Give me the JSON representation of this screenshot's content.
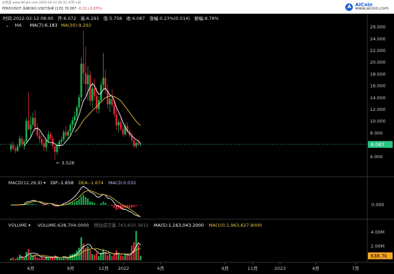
{
  "header": {
    "source_line": "分享自 www.AICoin.com   2022-02-14 20:12 (UTC+8)",
    "pair_line": "PERP/USDT 永续OKX USDT永续 [1日]",
    "pair_price": "76.087",
    "pair_change": "-0.13 (-2.05%)",
    "logo_name": "AICoin",
    "logo_url": "www.aicoin.com"
  },
  "info": {
    "time": "时间:2022-02-12 08:00",
    "open": "开:6.072",
    "high": "高:6.291",
    "low": "低:5.758",
    "close": "收:6.087",
    "change": "涨幅:0.23%(0.014)",
    "amplitude": "振幅:8.78%"
  },
  "ma_legend": {
    "chevron": "⌄",
    "label": "MA",
    "ma7": "MA(7):6.183",
    "ma30": "MA(30):9.292"
  },
  "macd_legend": {
    "label": "MACD(12,26,9) ▾",
    "dif": "DIF:-1.658",
    "dea": "DEA:-1.674",
    "macd": "MACD:0.032"
  },
  "vol_legend": {
    "label": "VOLUME ▾",
    "volume": "VOLUME:638,704.0000",
    "est": "预估成交量:763,810.3615",
    "ma5": "MA(5):1,163,043.2000",
    "ma10": "MA(10):1,963,627.8000"
  },
  "colors": {
    "up": "#1db954",
    "down": "#e0293a",
    "ma7": "#ffffff",
    "ma30": "#e8c547",
    "badge": "#26c281",
    "vol_badge": "#f5a623"
  },
  "chart_data": [
    {
      "type": "candlestick",
      "title": "PERP/USDT 1D",
      "ylim": [
        2,
        27
      ],
      "y_ticks": [
        "26.000",
        "24.000",
        "22.000",
        "20.000",
        "18.000",
        "16.000",
        "14.000",
        "12.000",
        "10.000",
        "8.000",
        "6.000",
        "4.000"
      ],
      "current_price": "6.087",
      "low_marker": "← 3.528",
      "x_ticks": [
        "6月",
        "9月",
        "12月",
        "2022",
        "4月",
        "9月",
        "11月",
        "2023",
        "4月",
        "7月"
      ],
      "candles": [
        [
          5.2,
          6.4,
          4.8,
          6.0
        ],
        [
          6.0,
          6.6,
          5.1,
          5.4
        ],
        [
          5.4,
          5.9,
          4.6,
          5.0
        ],
        [
          5.0,
          6.2,
          4.8,
          5.8
        ],
        [
          5.8,
          7.6,
          5.5,
          7.1
        ],
        [
          7.1,
          7.5,
          5.6,
          6.1
        ],
        [
          6.1,
          7.0,
          5.2,
          6.6
        ],
        [
          6.6,
          10.6,
          6.2,
          10.1
        ],
        [
          10.1,
          14.9,
          9.2,
          8.6
        ],
        [
          8.6,
          10.9,
          7.2,
          9.4
        ],
        [
          9.4,
          11.5,
          8.8,
          10.6
        ],
        [
          10.6,
          11.9,
          8.4,
          9.0
        ],
        [
          9.0,
          9.6,
          7.2,
          7.6
        ],
        [
          7.6,
          8.4,
          6.4,
          7.0
        ],
        [
          7.0,
          7.9,
          5.9,
          6.3
        ],
        [
          6.3,
          7.0,
          5.0,
          5.6
        ],
        [
          5.6,
          7.1,
          4.9,
          6.8
        ],
        [
          6.8,
          8.4,
          6.3,
          7.8
        ],
        [
          7.8,
          8.2,
          6.6,
          7.1
        ],
        [
          7.1,
          7.6,
          5.3,
          5.8
        ],
        [
          5.8,
          6.2,
          3.5,
          4.8
        ],
        [
          4.8,
          6.3,
          4.3,
          5.9
        ],
        [
          5.9,
          6.9,
          5.4,
          6.6
        ],
        [
          6.6,
          7.4,
          6.1,
          6.9
        ],
        [
          6.9,
          8.6,
          6.5,
          8.2
        ],
        [
          8.2,
          9.2,
          7.2,
          7.6
        ],
        [
          7.6,
          8.7,
          7.0,
          8.3
        ],
        [
          8.3,
          9.8,
          7.7,
          9.4
        ],
        [
          9.4,
          10.7,
          8.6,
          10.2
        ],
        [
          10.2,
          11.6,
          9.4,
          10.9
        ],
        [
          10.9,
          12.8,
          10.1,
          12.4
        ],
        [
          12.4,
          14.6,
          11.8,
          14.1
        ],
        [
          14.1,
          20.8,
          13.4,
          19.8
        ],
        [
          19.8,
          25.4,
          16.4,
          18.2
        ],
        [
          18.2,
          22.7,
          14.4,
          16.3
        ],
        [
          16.3,
          19.4,
          13.6,
          17.9
        ],
        [
          17.9,
          18.7,
          12.6,
          13.5
        ],
        [
          13.5,
          16.6,
          12.3,
          15.6
        ],
        [
          15.6,
          17.3,
          13.6,
          14.3
        ],
        [
          14.3,
          15.7,
          11.4,
          12.1
        ],
        [
          12.1,
          14.3,
          11.3,
          13.6
        ],
        [
          13.6,
          16.8,
          13.1,
          16.2
        ],
        [
          16.2,
          21.6,
          15.4,
          17.4
        ],
        [
          17.4,
          18.7,
          14.6,
          15.3
        ],
        [
          15.3,
          16.4,
          12.2,
          12.9
        ],
        [
          12.9,
          14.7,
          11.6,
          13.8
        ],
        [
          13.8,
          15.4,
          12.3,
          12.8
        ],
        [
          12.8,
          13.6,
          10.7,
          11.2
        ],
        [
          11.2,
          12.1,
          8.6,
          9.3
        ],
        [
          9.3,
          10.4,
          8.1,
          9.9
        ],
        [
          9.9,
          10.6,
          8.3,
          8.7
        ],
        [
          8.7,
          9.4,
          7.4,
          7.8
        ],
        [
          7.8,
          9.7,
          7.5,
          9.2
        ],
        [
          9.2,
          9.8,
          8.0,
          8.3
        ],
        [
          8.3,
          8.7,
          7.3,
          7.6
        ],
        [
          7.6,
          8.1,
          6.4,
          6.8
        ],
        [
          6.8,
          7.1,
          5.4,
          5.8
        ],
        [
          5.8,
          6.6,
          5.5,
          6.3
        ],
        [
          6.3,
          6.8,
          5.8,
          6.1
        ],
        [
          6.072,
          6.291,
          5.758,
          6.087
        ]
      ],
      "ma7": [
        null,
        null,
        null,
        null,
        null,
        null,
        5.8,
        6.3,
        6.8,
        7.3,
        8.2,
        8.8,
        8.8,
        8.6,
        8.0,
        7.5,
        6.9,
        6.5,
        6.4,
        6.4,
        6.2,
        5.9,
        5.9,
        5.9,
        6.1,
        6.6,
        7.0,
        7.5,
        8.3,
        9.1,
        10.1,
        11.1,
        12.3,
        13.5,
        14.1,
        15.0,
        15.8,
        16.4,
        16.1,
        15.2,
        14.6,
        14.7,
        15.4,
        15.6,
        15.1,
        14.5,
        14.3,
        13.5,
        12.4,
        11.6,
        10.8,
        9.8,
        9.0,
        8.4,
        8.0,
        7.6,
        7.2,
        6.9,
        6.7,
        6.2
      ],
      "ma30": [
        null,
        null,
        null,
        null,
        null,
        null,
        null,
        null,
        null,
        null,
        null,
        null,
        null,
        null,
        null,
        null,
        null,
        null,
        null,
        null,
        null,
        null,
        null,
        null,
        null,
        null,
        null,
        null,
        null,
        8.2,
        8.5,
        9.0,
        9.6,
        10.2,
        10.6,
        11.0,
        11.4,
        11.8,
        12.2,
        12.5,
        12.9,
        13.3,
        13.7,
        14.0,
        14.2,
        14.3,
        14.3,
        14.2,
        14.0,
        13.8,
        13.5,
        13.0,
        12.5,
        12.0,
        11.5,
        11.0,
        10.5,
        10.0,
        9.6,
        9.3
      ]
    },
    {
      "type": "bar",
      "title": "MACD(12,26,9)",
      "y_ticks": [
        "0.000"
      ],
      "ylim": [
        -1.6,
        2.6
      ],
      "dif_label": "DIF",
      "dea_label": "DEA",
      "hist": [
        0.02,
        0.01,
        -0.02,
        -0.01,
        0.03,
        0.02,
        0.03,
        0.15,
        0.12,
        0.14,
        0.16,
        0.1,
        0.02,
        -0.02,
        -0.06,
        -0.1,
        -0.05,
        0.04,
        0.02,
        -0.06,
        -0.16,
        -0.1,
        -0.02,
        0.02,
        0.12,
        0.14,
        0.18,
        0.25,
        0.35,
        0.45,
        0.6,
        0.8,
        1.2,
        1.4,
        1.1,
        0.9,
        0.5,
        0.45,
        0.3,
        0.05,
        0.05,
        0.25,
        0.45,
        0.3,
        -0.1,
        -0.05,
        -0.15,
        -0.4,
        -0.7,
        -0.55,
        -0.6,
        -0.65,
        -0.4,
        -0.45,
        -0.4,
        -0.35,
        -0.3,
        -0.15,
        -0.05,
        0.032
      ],
      "dif": [
        0,
        0,
        0,
        0,
        0.05,
        0.05,
        0.1,
        0.4,
        0.45,
        0.55,
        0.65,
        0.6,
        0.5,
        0.4,
        0.25,
        0.1,
        0.1,
        0.2,
        0.2,
        0.1,
        -0.1,
        -0.15,
        -0.1,
        0,
        0.2,
        0.3,
        0.45,
        0.65,
        0.9,
        1.15,
        1.5,
        1.9,
        2.4,
        2.6,
        2.4,
        2.2,
        1.8,
        1.7,
        1.5,
        1.15,
        1.05,
        1.25,
        1.5,
        1.35,
        0.95,
        0.9,
        0.7,
        0.3,
        -0.1,
        -0.15,
        -0.35,
        -0.6,
        -0.6,
        -0.75,
        -0.9,
        -1.05,
        -1.3,
        -1.45,
        -1.55,
        -1.658
      ],
      "dea": [
        0,
        0,
        0,
        0,
        0.02,
        0.03,
        0.05,
        0.15,
        0.25,
        0.35,
        0.45,
        0.5,
        0.5,
        0.45,
        0.4,
        0.3,
        0.22,
        0.2,
        0.2,
        0.18,
        0.1,
        0,
        -0.05,
        -0.05,
        0,
        0.08,
        0.18,
        0.3,
        0.45,
        0.65,
        0.85,
        1.1,
        1.4,
        1.7,
        1.9,
        2.0,
        2.0,
        1.9,
        1.8,
        1.65,
        1.5,
        1.45,
        1.45,
        1.4,
        1.3,
        1.2,
        1.0,
        0.8,
        0.55,
        0.35,
        0.15,
        -0.05,
        -0.2,
        -0.35,
        -0.55,
        -0.75,
        -0.95,
        -1.2,
        -1.45,
        -1.674
      ]
    },
    {
      "type": "bar",
      "title": "VOLUME",
      "y_ticks": [
        "4.00M",
        "2.00M"
      ],
      "ylim": [
        0,
        4.6
      ],
      "current_volume": "638.7k",
      "volume": [
        0.3,
        0.4,
        0.2,
        0.4,
        0.8,
        0.5,
        0.3,
        1.2,
        1.6,
        0.9,
        0.7,
        0.8,
        0.4,
        0.3,
        0.5,
        0.3,
        0.5,
        0.4,
        0.3,
        0.5,
        0.7,
        0.4,
        0.3,
        0.3,
        0.6,
        0.4,
        0.5,
        0.8,
        0.9,
        1.0,
        1.4,
        1.8,
        3.3,
        2.4,
        1.8,
        2.0,
        1.5,
        0.9,
        0.8,
        1.1,
        0.6,
        1.1,
        1.6,
        1.2,
        0.7,
        0.9,
        0.6,
        1.0,
        1.4,
        0.8,
        0.7,
        0.6,
        0.9,
        0.8,
        0.6,
        2.1,
        2.6,
        4.2,
        2.2,
        0.64
      ],
      "ma5": [
        null,
        null,
        null,
        null,
        0.4,
        0.5,
        0.4,
        0.6,
        0.9,
        1.0,
        1.0,
        1.0,
        0.9,
        0.6,
        0.5,
        0.5,
        0.4,
        0.4,
        0.4,
        0.4,
        0.5,
        0.5,
        0.4,
        0.4,
        0.5,
        0.4,
        0.4,
        0.5,
        0.6,
        0.7,
        0.9,
        1.2,
        1.6,
        2.0,
        2.1,
        2.3,
        2.2,
        1.7,
        1.6,
        1.3,
        1.0,
        0.9,
        1.0,
        1.1,
        1.0,
        1.1,
        1.0,
        0.9,
        0.9,
        0.9,
        0.9,
        0.9,
        0.9,
        0.8,
        0.7,
        1.0,
        1.4,
        2.0,
        2.5,
        2.2
      ],
      "ma10": [
        null,
        null,
        null,
        null,
        null,
        null,
        null,
        null,
        null,
        0.6,
        0.6,
        0.7,
        0.7,
        0.7,
        0.7,
        0.7,
        0.6,
        0.6,
        0.5,
        0.5,
        0.4,
        0.4,
        0.4,
        0.4,
        0.5,
        0.5,
        0.4,
        0.4,
        0.5,
        0.6,
        0.7,
        0.8,
        1.0,
        1.3,
        1.4,
        1.5,
        1.6,
        1.7,
        1.6,
        1.7,
        1.6,
        1.5,
        1.4,
        1.4,
        1.3,
        1.1,
        1.0,
        0.9,
        1.0,
        1.0,
        0.9,
        0.9,
        0.9,
        0.9,
        0.9,
        1.0,
        1.2,
        1.5,
        1.6,
        1.7
      ]
    }
  ]
}
